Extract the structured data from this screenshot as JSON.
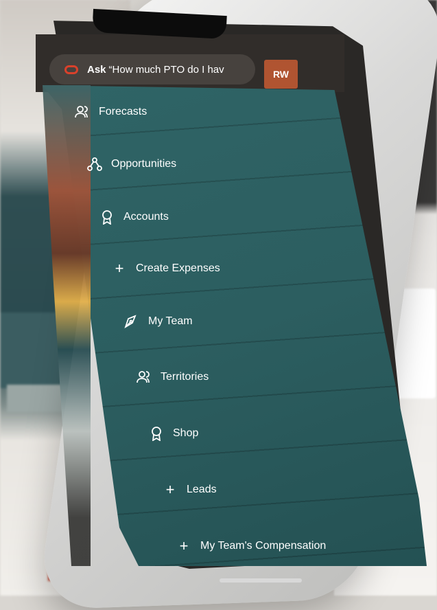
{
  "search": {
    "label": "Ask",
    "query": "“How much PTO do I hav"
  },
  "user": {
    "initials": "RW"
  },
  "menu": [
    {
      "label": "Forecasts",
      "icon": "people-icon"
    },
    {
      "label": "Opportunities",
      "icon": "hierarchy-icon"
    },
    {
      "label": "Accounts",
      "icon": "award-icon"
    },
    {
      "label": "Create Expenses",
      "icon": "plus-icon"
    },
    {
      "label": "My Team",
      "icon": "pen-icon"
    },
    {
      "label": "Territories",
      "icon": "people-icon"
    },
    {
      "label": "Shop",
      "icon": "award-icon"
    },
    {
      "label": "Leads",
      "icon": "plus-icon"
    },
    {
      "label": "My Team's Compensation",
      "icon": "plus-icon"
    }
  ],
  "colors": {
    "accent": "#b05431",
    "menu_bg": "#2c5e60",
    "topbar": "#312d2a",
    "logo": "#d9412b"
  }
}
